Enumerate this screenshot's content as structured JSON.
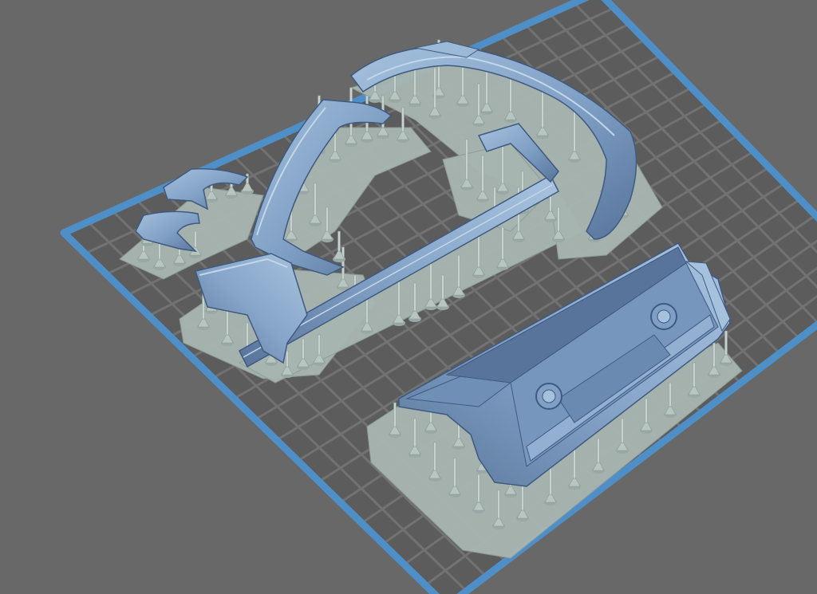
{
  "app": {
    "view": "3d-slicer-viewport"
  },
  "scene": {
    "background_color": "#686868",
    "plate_color": "#5c5c5c",
    "grid_color": "#727272",
    "plate_border_color": "#4f8fc8",
    "raft_color": "#a8b6b2",
    "raft_edge_color": "#8e9c98",
    "support_color": "#b8c6c2",
    "model_color": "#7f9fc4",
    "model_highlight": "#a6c1de",
    "model_shadow": "#58749a",
    "model_outline": "#3f5a80",
    "objects": [
      "front-bumper-part",
      "fender-part-left",
      "fender-part-small-1",
      "fender-part-small-2",
      "rear-panel-part"
    ]
  }
}
